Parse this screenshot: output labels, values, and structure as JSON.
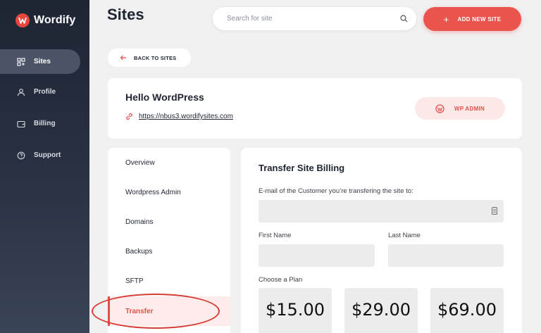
{
  "app": {
    "name": "Wordify"
  },
  "sidebar": {
    "items": [
      {
        "label": "Sites",
        "icon": "grid-icon",
        "active": true
      },
      {
        "label": "Profile",
        "icon": "user-icon",
        "active": false
      },
      {
        "label": "Billing",
        "icon": "wallet-icon",
        "active": false
      },
      {
        "label": "Support",
        "icon": "support-icon",
        "active": false
      }
    ]
  },
  "header": {
    "title": "Sites",
    "search_placeholder": "Search for site",
    "add_label": "ADD NEW SITE"
  },
  "back_label": "BACK TO SITES",
  "site": {
    "greeting": "Hello WordPress",
    "url": "https://nbus3.wordifysites.com",
    "wp_admin_label": "WP ADMIN"
  },
  "menu": {
    "items": [
      "Overview",
      "Wordpress Admin",
      "Domains",
      "Backups",
      "SFTP",
      "Transfer"
    ],
    "active": "Transfer"
  },
  "transfer": {
    "title": "Transfer Site Billing",
    "email_label": "E-mail of the Customer you’re transfering the site to:",
    "email_value": "",
    "first_name_label": "First Name",
    "first_name_value": "",
    "last_name_label": "Last Name",
    "last_name_value": "",
    "plan_label": "Choose a Plan",
    "plans": [
      "$15.00",
      "$29.00",
      "$69.00"
    ]
  },
  "colors": {
    "accent": "#e9544d",
    "sidebar_bg": "#1e2533",
    "active_bg": "#fdeceb"
  }
}
